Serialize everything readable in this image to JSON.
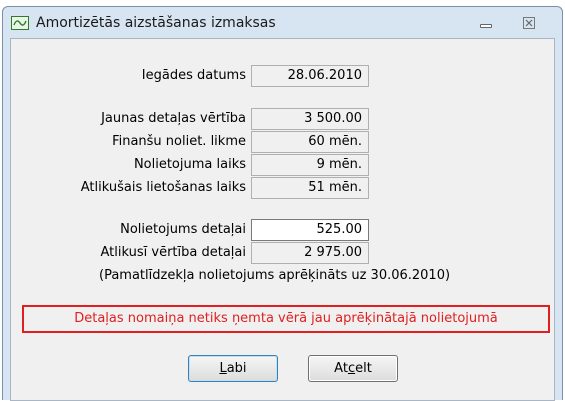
{
  "window": {
    "title": "Amortizētās aizstāšanas izmaksas",
    "minimize_glyph": "▭",
    "close_glyph": "☒"
  },
  "fields": {
    "purchase_date": {
      "label": "Iegādes datums",
      "value": "28.06.2010"
    },
    "new_part_value": {
      "label": "Jaunas detaļas vērtība",
      "value": "3 500.00"
    },
    "depreciation_rate": {
      "label": "Finanšu noliet. likme",
      "value": "60 mēn."
    },
    "depreciation_time": {
      "label": "Nolietojuma laiks",
      "value": "9 mēn."
    },
    "remaining_use_time": {
      "label": "Atlikušais lietošanas laiks",
      "value": "51 mēn."
    },
    "part_depreciation": {
      "label": "Nolietojums detaļai",
      "value": "525.00"
    },
    "remaining_value": {
      "label": "Atlikusī vērtība detaļai",
      "value": "2 975.00"
    }
  },
  "note": "(Pamatlīdzekļa nolietojums aprēķināts uz 30.06.2010)",
  "warning": "Detaļas nomaiņa netiks ņemta vērā jau aprēķinātajā nolietojumā",
  "buttons": {
    "ok": {
      "mnemonic": "L",
      "rest": "abi"
    },
    "cancel": {
      "before": "At",
      "mnemonic": "c",
      "after": "elt"
    }
  },
  "colors": {
    "warning": "#e02020",
    "window_frame": "#d7e4f2",
    "client_bg": "#f0f0f0"
  },
  "icons": {
    "app": "chart-window-icon",
    "minimize": "minimize-icon",
    "close": "close-icon"
  }
}
